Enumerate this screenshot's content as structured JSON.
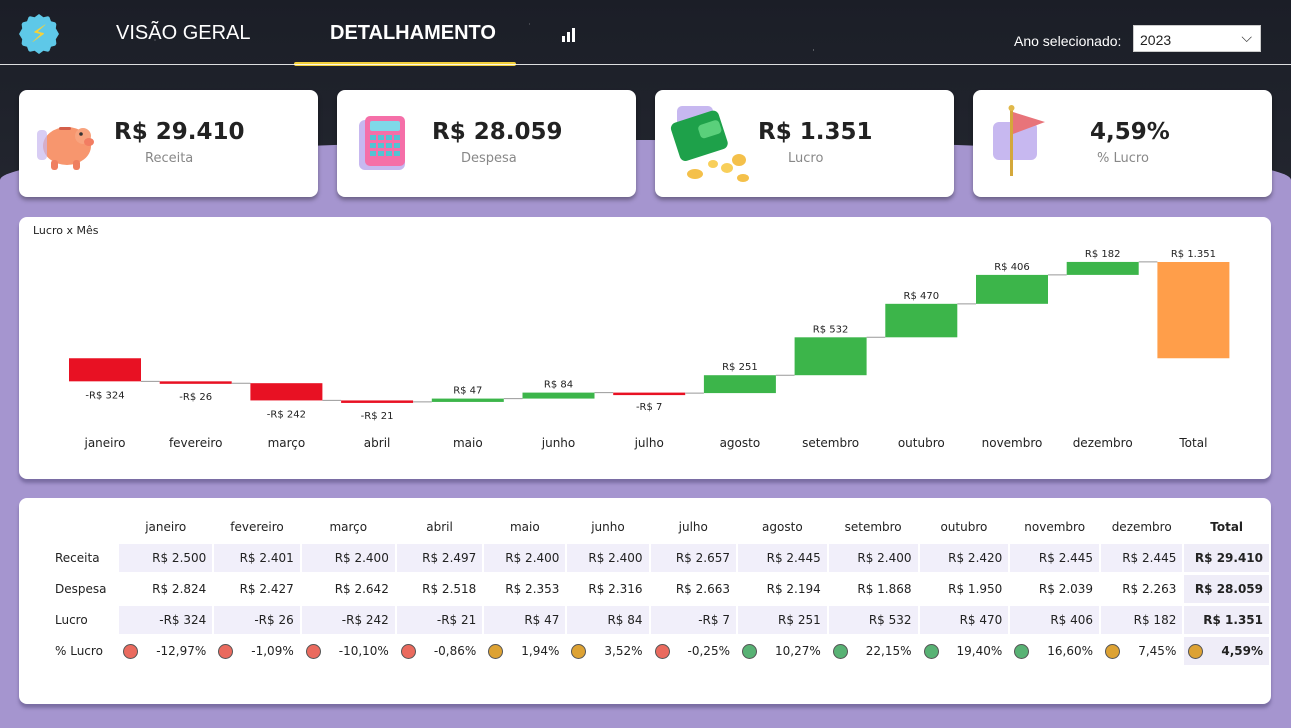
{
  "nav": {
    "tab_overview": "VISÃO GERAL",
    "tab_detail": "DETALHAMENTO",
    "year_label": "Ano selecionado:",
    "year_value": "2023"
  },
  "kpis": [
    {
      "value": "R$ 29.410",
      "label": "Receita",
      "icon": "piggy-bank-icon"
    },
    {
      "value": "R$ 28.059",
      "label": "Despesa",
      "icon": "calculator-icon"
    },
    {
      "value": "R$ 1.351",
      "label": "Lucro",
      "icon": "wallet-coins-icon"
    },
    {
      "value": "4,59%",
      "label": "% Lucro",
      "icon": "flag-icon"
    }
  ],
  "colors": {
    "negative": "#e81123",
    "positive": "#3cb54a",
    "total": "#ff9e4a",
    "accent": "#f2cf3c",
    "purple": "#a595cf",
    "dot_red": "#ea6a5e",
    "dot_orange": "#dda233",
    "dot_green": "#58b274"
  },
  "chart_data": {
    "type": "waterfall",
    "title": "Lucro x Mês",
    "categories": [
      "janeiro",
      "fevereiro",
      "março",
      "abril",
      "maio",
      "junho",
      "julho",
      "agosto",
      "setembro",
      "outubro",
      "novembro",
      "dezembro",
      "Total"
    ],
    "values": [
      -324,
      -26,
      -242,
      -21,
      47,
      84,
      -7,
      251,
      532,
      470,
      406,
      182,
      1351
    ],
    "labels": [
      "-R$ 324",
      "-R$ 26",
      "-R$ 242",
      "-R$ 21",
      "R$ 47",
      "R$ 84",
      "-R$ 7",
      "R$ 251",
      "R$ 532",
      "R$ 470",
      "R$ 406",
      "R$ 182",
      "R$ 1.351"
    ],
    "ylim": [
      -614,
      1351
    ],
    "grid": false,
    "legend": "none"
  },
  "table": {
    "columns": [
      "janeiro",
      "fevereiro",
      "março",
      "abril",
      "maio",
      "junho",
      "julho",
      "agosto",
      "setembro",
      "outubro",
      "novembro",
      "dezembro",
      "Total"
    ],
    "rows": [
      {
        "label": "Receita",
        "values": [
          "R$ 2.500",
          "R$ 2.401",
          "R$ 2.400",
          "R$ 2.497",
          "R$ 2.400",
          "R$ 2.400",
          "R$ 2.657",
          "R$ 2.445",
          "R$ 2.400",
          "R$ 2.420",
          "R$ 2.445",
          "R$ 2.445",
          "R$ 29.410"
        ]
      },
      {
        "label": "Despesa",
        "values": [
          "R$ 2.824",
          "R$ 2.427",
          "R$ 2.642",
          "R$ 2.518",
          "R$ 2.353",
          "R$ 2.316",
          "R$ 2.663",
          "R$ 2.194",
          "R$ 1.868",
          "R$ 1.950",
          "R$ 2.039",
          "R$ 2.263",
          "R$ 28.059"
        ]
      },
      {
        "label": "Lucro",
        "values": [
          "-R$ 324",
          "-R$ 26",
          "-R$ 242",
          "-R$ 21",
          "R$ 47",
          "R$ 84",
          "-R$ 7",
          "R$ 251",
          "R$ 532",
          "R$ 470",
          "R$ 406",
          "R$ 182",
          "R$ 1.351"
        ]
      }
    ],
    "pct_row": {
      "label": "% Lucro",
      "values": [
        "-12,97%",
        "-1,09%",
        "-10,10%",
        "-0,86%",
        "1,94%",
        "3,52%",
        "-0,25%",
        "10,27%",
        "22,15%",
        "19,40%",
        "16,60%",
        "7,45%",
        "4,59%"
      ],
      "status": [
        "red",
        "red",
        "red",
        "red",
        "orange",
        "orange",
        "red",
        "green",
        "green",
        "green",
        "green",
        "orange",
        "orange"
      ]
    }
  }
}
